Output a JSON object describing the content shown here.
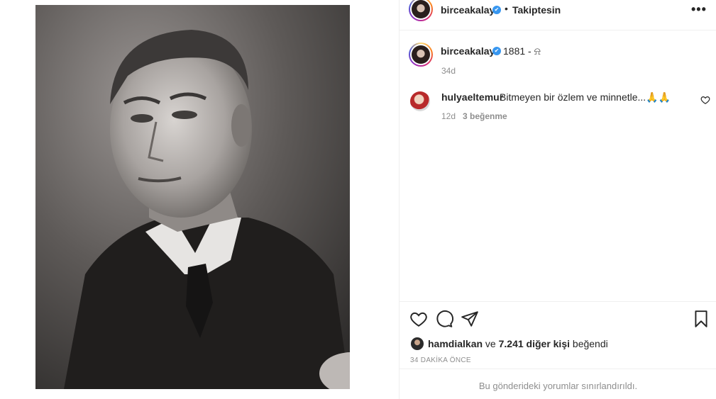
{
  "header": {
    "username": "birceakalay",
    "verified_mark": "✔",
    "separator": "•",
    "follow_status": "Takiptesin",
    "more_label": "•••"
  },
  "caption": {
    "username": "birceakalay",
    "text": "1881 - ⍾",
    "time": "34d"
  },
  "comments": [
    {
      "username": "hulyaeltemur",
      "text": "Bitmeyen bir özlem ve minnetle...🙏🙏",
      "time": "12d",
      "likes": "3 beğenme",
      "like_icon": "heart-outline-icon"
    }
  ],
  "actions": {
    "icons": [
      "heart-icon",
      "comment-icon",
      "share-icon",
      "bookmark-icon"
    ]
  },
  "likes": {
    "first_user": "hamdialkan",
    "connector": "ve",
    "others": "7.241 diğer kişi",
    "suffix": "beğendi"
  },
  "time_ago": "34 DAKİKA ÖNCE",
  "comments_limited": "Bu gönderideki yorumlar sınırlandırıldı.",
  "colors": {
    "verified_blue": "#3897f0",
    "muted_text": "#8e8e8e",
    "primary_text": "#262626",
    "divider": "#efefef"
  }
}
